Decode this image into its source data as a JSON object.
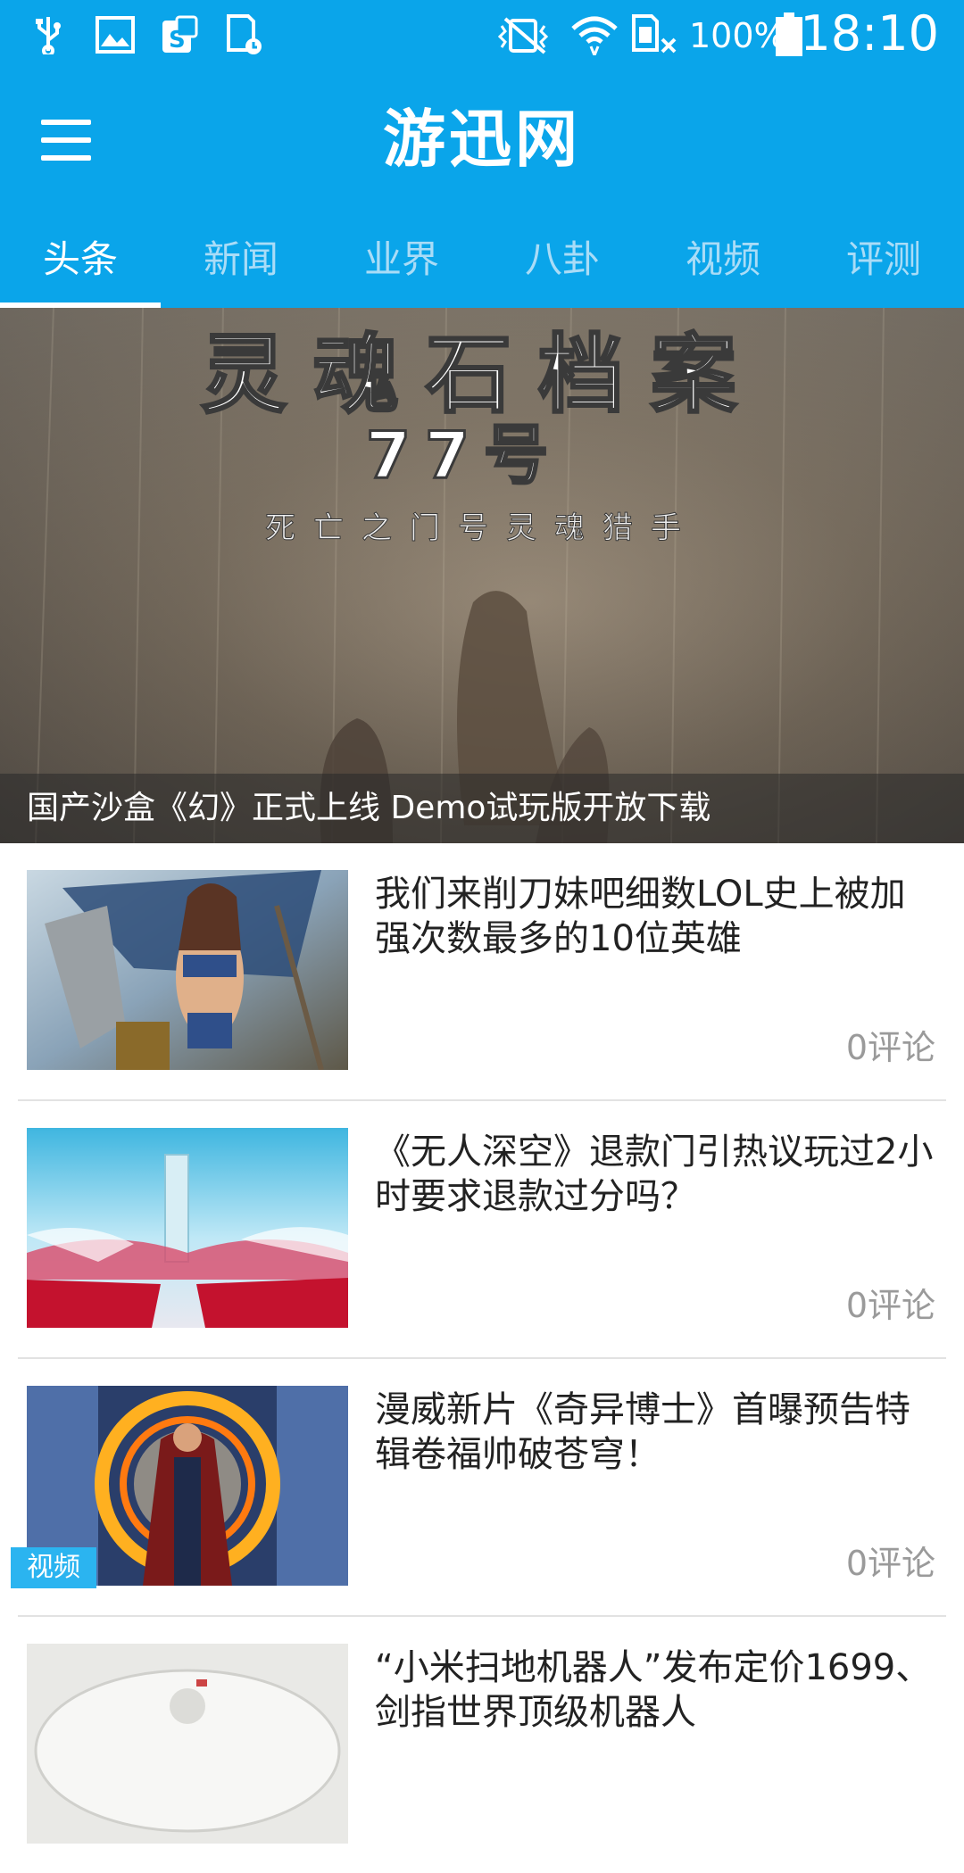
{
  "status_bar": {
    "icons": [
      "usb-icon",
      "image-icon",
      "s-app-icon",
      "sd-card-icon",
      "vibrate-icon",
      "wifi-icon",
      "no-sim-icon",
      "battery-icon"
    ],
    "battery": "100%",
    "time": "18:10"
  },
  "app": {
    "title": "游迅网",
    "accent": "#0aa5ea"
  },
  "tabs": [
    {
      "label": "头条",
      "active": true
    },
    {
      "label": "新闻",
      "active": false
    },
    {
      "label": "业界",
      "active": false
    },
    {
      "label": "八卦",
      "active": false
    },
    {
      "label": "视频",
      "active": false
    },
    {
      "label": "评测",
      "active": false
    }
  ],
  "hero": {
    "poster_title": "灵魂石档案",
    "poster_number": "77号",
    "poster_subtitle": "死亡之门号灵魂猎手",
    "caption": "国产沙盒《幻》正式上线 Demo试玩版开放下载"
  },
  "articles": [
    {
      "title": "我们来削刀妹吧细数LOL史上被加强次数最多的10位英雄",
      "comments": "0评论",
      "badge": ""
    },
    {
      "title": "《无人深空》退款门引热议玩过2小时要求退款过分吗？",
      "comments": "0评论",
      "badge": ""
    },
    {
      "title": "漫威新片《奇异博士》首曝预告特辑卷福帅破苍穹！",
      "comments": "0评论",
      "badge": "视频"
    },
    {
      "title": "“小米扫地机器人”发布定价1699、剑指世界顶级机器人",
      "comments": "",
      "badge": ""
    }
  ]
}
